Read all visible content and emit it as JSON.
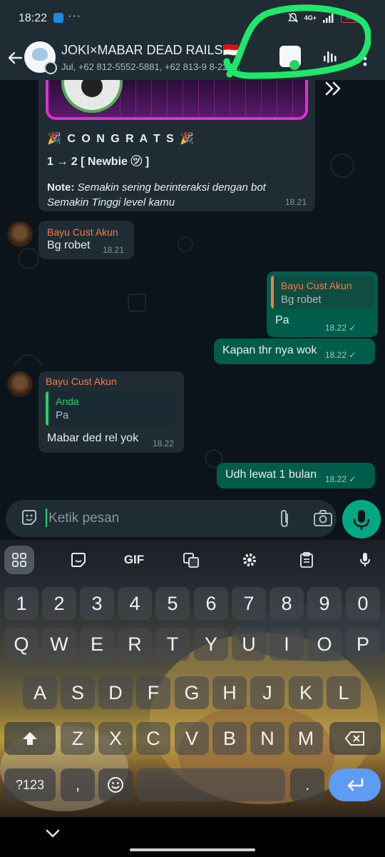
{
  "status_bar": {
    "time": "18:22",
    "notification_icon": "app-notification-icon",
    "overflow_dots": "···",
    "network_label": "4G+",
    "battery_level": "15",
    "icons": [
      "mute-icon",
      "signal-icon",
      "battery-icon"
    ]
  },
  "header": {
    "title": "JOKI×MABAR DEAD RAILS🇮🇩",
    "subtitle": "Jul, +62 812-5552-5881, +62 813-9  8-224...",
    "back_icon": "arrow-left-icon",
    "audio_icon": "audio-waveform-icon",
    "more_icon": "more-vertical-icon"
  },
  "messages": {
    "bot_card": {
      "congrats_title": "🎉 C O N G R A T S 🎉",
      "level_text": "1 → 2 [ Newbie ㋡ ]",
      "note_label": "Note:",
      "note_line1": "Semakin sering berinteraksi dengan bot",
      "note_line2": "Semakin Tinggi level kamu",
      "time": "18.21"
    },
    "m1": {
      "sender": "Bayu Cust Akun",
      "text": "Bg robet",
      "time": "18.21"
    },
    "m2": {
      "quote_name": "Bayu Cust Akun",
      "quote_text": "Bg robet",
      "text": "Pa",
      "time": "18.22 ✓"
    },
    "m3": {
      "text": "Kapan thr nya wok",
      "time": "18.22 ✓"
    },
    "m4": {
      "sender": "Bayu Cust Akun",
      "quote_name": "Anda",
      "quote_text": "Pa",
      "text": "Mabar ded rel yok",
      "time": "18.22"
    },
    "m5": {
      "text": "Udh lewat 1 bulan",
      "time": "18.22 ✓"
    }
  },
  "composer": {
    "placeholder": "Ketik pesan"
  },
  "keyboard": {
    "toolbar": {
      "gif_label": "GIF"
    },
    "number_row": [
      "1",
      "2",
      "3",
      "4",
      "5",
      "6",
      "7",
      "8",
      "9",
      "0"
    ],
    "row1": [
      "Q",
      "W",
      "E",
      "R",
      "T",
      "Y",
      "U",
      "I",
      "O",
      "P"
    ],
    "row2": [
      "A",
      "S",
      "D",
      "F",
      "G",
      "H",
      "J",
      "K",
      "L"
    ],
    "row3": [
      "Z",
      "X",
      "C",
      "V",
      "B",
      "N",
      "M"
    ],
    "symbols_label": "?123",
    "comma_label": ",",
    "period_label": "."
  },
  "colors": {
    "outgoing_bubble": "#005c4b",
    "incoming_bubble": "#1f2c34",
    "sender_name": "#f47c4a",
    "accent_green": "#25d366",
    "highlight_annotation": "#1ee86a"
  }
}
